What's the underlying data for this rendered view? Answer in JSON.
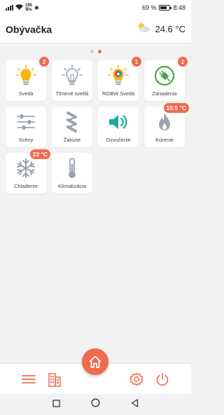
{
  "statusbar": {
    "speed_value": "195",
    "speed_unit": "B/s",
    "battery": "69 %",
    "time": "8:48"
  },
  "header": {
    "title": "Obývačka",
    "weather_icon": "partly-cloudy-icon",
    "temperature": "24.6 °C"
  },
  "pager": {
    "pages": 2,
    "active": 2
  },
  "tiles": [
    {
      "label": "Svetlá",
      "icon": "bulb-on-icon",
      "badge": "2"
    },
    {
      "label": "Tlmené svetlá",
      "icon": "bulb-dim-icon",
      "badge": ""
    },
    {
      "label": "RGBW Svetlá",
      "icon": "rgbw-bulb-icon",
      "badge": "1"
    },
    {
      "label": "Zariadenia",
      "icon": "plug-icon",
      "badge": "2"
    },
    {
      "label": "Scény",
      "icon": "sliders-icon",
      "badge": ""
    },
    {
      "label": "Žalúzie",
      "icon": "blinds-icon",
      "badge": ""
    },
    {
      "label": "Ozvučenie",
      "icon": "speaker-icon",
      "badge": ""
    },
    {
      "label": "Kúrenie",
      "icon": "flame-icon",
      "badge": "19.5 °C"
    },
    {
      "label": "Chladenie",
      "icon": "snowflake-icon",
      "badge": "23 °C"
    },
    {
      "label": "Klimatizácia",
      "icon": "thermometer-icon",
      "badge": ""
    }
  ],
  "bottomnav": [
    "menu-icon",
    "building-icon",
    "home-icon",
    "settings-icon",
    "power-icon"
  ],
  "colors": {
    "accent": "#f06a4d",
    "icon_gray": "#9aa3ab",
    "teal": "#1fa79b",
    "yellow": "#f6b61b",
    "green": "#4aa845"
  }
}
